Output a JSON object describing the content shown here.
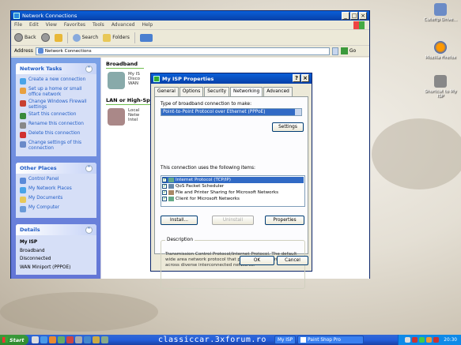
{
  "desktop": {
    "icons": [
      {
        "label": "Cuteftp Drive...",
        "name": "cuteftp-icon"
      },
      {
        "label": "Mozilla Firefox",
        "name": "firefox-icon"
      },
      {
        "label": "Shortcut to My ISP",
        "name": "shortcut-isp-icon"
      }
    ]
  },
  "explorer": {
    "title": "Network Connections",
    "menu": [
      "File",
      "Edit",
      "View",
      "Favorites",
      "Tools",
      "Advanced",
      "Help"
    ],
    "toolbar": {
      "back": "Back",
      "search": "Search",
      "folders": "Folders"
    },
    "address_label": "Address",
    "address_value": "Network Connections",
    "go_label": "Go",
    "network_tasks": {
      "title": "Network Tasks",
      "items": [
        "Create a new connection",
        "Set up a home or small office network",
        "Change Windows Firewall settings",
        "Start this connection",
        "Rename this connection",
        "Delete this connection",
        "Change settings of this connection"
      ]
    },
    "other_places": {
      "title": "Other Places",
      "items": [
        "Control Panel",
        "My Network Places",
        "My Documents",
        "My Computer"
      ]
    },
    "details": {
      "title": "Details",
      "name": "My ISP",
      "lines": [
        "Broadband",
        "Disconnected",
        "WAN Miniport (PPPOE)"
      ]
    },
    "groups": {
      "broadband": "Broadband",
      "lan": "LAN or High-Sp"
    },
    "connections": {
      "isp": [
        "My IS",
        "Disco",
        "WAN"
      ],
      "local": [
        "Local",
        "Netw",
        "Intel"
      ]
    }
  },
  "dialog": {
    "title": "My ISP Properties",
    "tabs": [
      "General",
      "Options",
      "Security",
      "Networking",
      "Advanced"
    ],
    "active_tab": "Networking",
    "type_label": "Type of broadband connection to make:",
    "type_value": "Point-to-Point Protocol over Ethernet (PPPoE)",
    "settings_button": "Settings",
    "components_label": "This connection uses the following items:",
    "components": [
      "Internet Protocol (TCP/IP)",
      "QoS Packet Scheduler",
      "File and Printer Sharing for Microsoft Networks",
      "Client for Microsoft Networks"
    ],
    "install_button": "Install...",
    "uninstall_button": "Uninstall",
    "properties_button": "Properties",
    "description_title": "Description",
    "description_text": "Transmission Control Protocol/Internet Protocol. The default wide area network protocol that provides communication across diverse interconnected networks.",
    "ok_button": "OK",
    "cancel_button": "Cancel"
  },
  "taskbar": {
    "start_label": "Start",
    "watermark": "classiccar.3xforum.ro",
    "tasks": [
      "My ISP",
      "Paint Shop Pro"
    ],
    "clock": "20:30"
  },
  "colors": {
    "xp_blue": "#0a5fd8",
    "task_green": "#3c9a3c",
    "selection": "#316ac5"
  }
}
